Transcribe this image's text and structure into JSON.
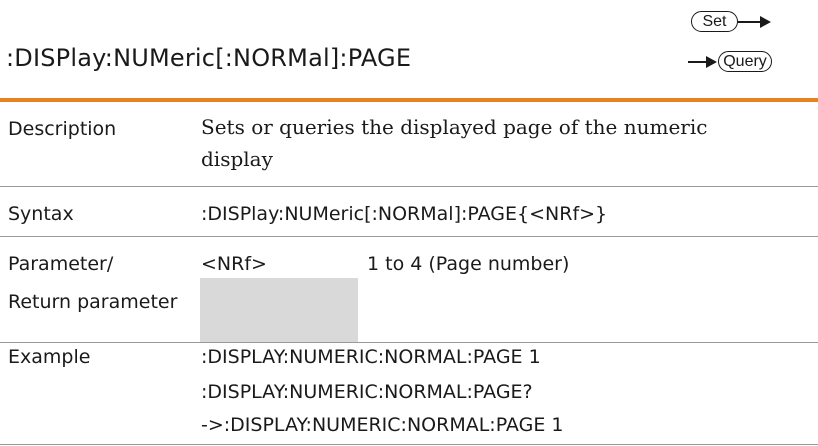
{
  "title": ":DISPlay:NUMeric[:NORMal]:PAGE",
  "badges": {
    "set": "Set",
    "query": "Query"
  },
  "rows": {
    "description": {
      "label": "Description",
      "line1": "Sets or queries the displayed page of the numeric",
      "line2": "display"
    },
    "syntax": {
      "label": "Syntax",
      "value": ":DISPlay:NUMeric[:NORMal]:PAGE{<NRf>}"
    },
    "parameter": {
      "label_line1": "Parameter/",
      "label_line2": "Return parameter",
      "name": "<NRf>",
      "desc": "1 to 4 (Page number)"
    },
    "example": {
      "label": "Example",
      "line1": ":DISPLAY:NUMERIC:NORMAL:PAGE 1",
      "line2": ":DISPLAY:NUMERIC:NORMAL:PAGE?",
      "line3": "->:DISPLAY:NUMERIC:NORMAL:PAGE 1"
    }
  },
  "colors": {
    "accent_rule": "#e8821e",
    "param_shade": "#d9d9d9",
    "row_line": "#9a9a9a"
  }
}
